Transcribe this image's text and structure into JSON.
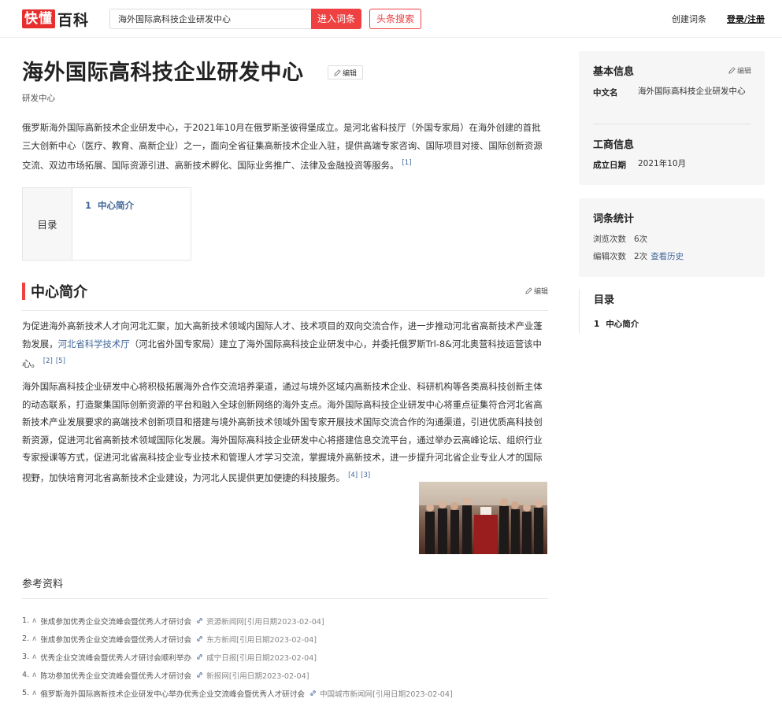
{
  "header": {
    "logo_mark": "快懂",
    "logo_text": "百科",
    "search_value": "海外国际高科技企业研发中心",
    "search_button": "进入词条",
    "toutiao_button": "头条搜索",
    "create_link": "创建词条",
    "login_link": "登录/注册"
  },
  "article": {
    "title": "海外国际高科技企业研发中心",
    "edit_label": "编辑",
    "subtitle": "研发中心",
    "summary": "俄罗斯海外国际高新技术企业研发中心，于2021年10月在俄罗斯圣彼得堡成立。是河北省科技厅（外国专家局）在海外创建的首批三大创新中心（医疗、教育、高新企业）之一，面向全省征集高新技术企业入驻，提供高端专家咨询、国际项目对接、国际创新资源交流、双边市场拓展、国际资源引进、高新技术孵化、国际业务推广、法律及金融投资等服务。",
    "summary_ref": "[1]",
    "toc": {
      "label": "目录",
      "items": [
        {
          "num": "1",
          "text": "中心简介"
        }
      ]
    },
    "section": {
      "title": "中心简介",
      "edit_label": "编辑",
      "para1_a": "为促进海外高新技术人才向河北汇聚，加大高新技术领域内国际人才、技术项目的双向交流合作，进一步推动河北省高新技术产业蓬勃发展，",
      "para1_link": "河北省科学技术厅",
      "para1_b": "（河北省外国专家局）建立了海外国际高科技企业研发中心，并委托俄罗斯Trl-8&河北奥营科技运营该中心。",
      "para1_refs": [
        "[2]",
        "[5]"
      ],
      "para2": "海外国际高科技企业研发中心将积极拓展海外合作交流培养渠道，通过与境外区域内高新技术企业、科研机构等各类高科技创新主体的动态联系，打造聚集国际创新资源的平台和融入全球创新网络的海外支点。海外国际高科技企业研发中心将重点征集符合河北省高新技术产业发展要求的高端技术创新项目和搭建与境外高新技术领域外国专家开展技术国际交流合作的沟通渠道，引进优质高科技创新资源，促进河北省高新技术领域国际化发展。海外国际高科技企业研发中心将搭建信息交流平台，通过举办云高峰论坛、组织行业专家授课等方式，促进河北省高科技企业专业技术和管理人才学习交流，掌握境外高新技术，进一步提升河北省企业专业人才的国际视野，加快培育河北省高新技术企业建设，为河北人民提供更加便捷的科技服务。",
      "para2_refs": [
        "[4]",
        "[3]"
      ]
    }
  },
  "references": {
    "title": "参考资料",
    "items": [
      {
        "num": "1.",
        "caret": "∧",
        "title": "张成参加优秀企业交流峰会暨优秀人才研讨会",
        "source": "资源新闻网[引用日期2023-02-04]"
      },
      {
        "num": "2.",
        "caret": "∧",
        "title": "张成参加优秀企业交流峰会暨优秀人才研讨会",
        "source": "东方新闻[引用日期2023-02-04]"
      },
      {
        "num": "3.",
        "caret": "∧",
        "title": "优秀企业交流峰会暨优秀人才研讨会顺利举办",
        "source": "咸宁日报[引用日期2023-02-04]"
      },
      {
        "num": "4.",
        "caret": "∧",
        "title": "陈功参加优秀企业交流峰会暨优秀人才研讨会",
        "source": "新报网[引用日期2023-02-04]"
      },
      {
        "num": "5.",
        "caret": "∧",
        "title": "俄罗斯海外国际高新技术企业研发中心举办优秀企业交流峰会暨优秀人才研讨会",
        "source": "中国城市新闻网[引用日期2023-02-04]"
      }
    ]
  },
  "sidebar": {
    "basic": {
      "title": "基本信息",
      "edit_label": "编辑",
      "cn_name_key": "中文名",
      "cn_name_val": "海外国际高科技企业研发中心",
      "biz_title": "工商信息",
      "founded_key": "成立日期",
      "founded_val": "2021年10月"
    },
    "stats": {
      "title": "词条统计",
      "views_key": "浏览次数",
      "views_val": "6次",
      "edits_key": "编辑次数",
      "edits_val": "2次",
      "history_link": "查看历史"
    },
    "toc": {
      "title": "目录",
      "items": [
        {
          "num": "1",
          "text": "中心简介"
        }
      ]
    }
  },
  "colors": {
    "brand_red": "#f04142",
    "link_blue": "#406599"
  },
  "icons": {
    "edit": "pencil-icon",
    "ref_link": "link-icon"
  }
}
